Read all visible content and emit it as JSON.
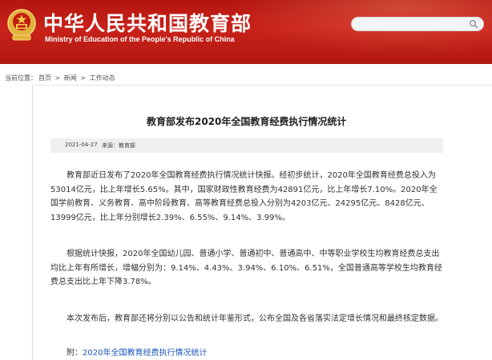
{
  "header": {
    "title": "中华人民共和国教育部",
    "subtitle": "Ministry of Education of the People's Republic of China",
    "search": {
      "value": "",
      "placeholder": ""
    },
    "colors": {
      "banner": "#c01d15"
    }
  },
  "breadcrumb": {
    "label": "当前位置：",
    "items": [
      "首页",
      "新闻",
      "工作动态"
    ],
    "separator": ">"
  },
  "article": {
    "title": "教育部发布2020年全国教育经费执行情况统计",
    "date": "2021-04-27",
    "source": "来源：教育部",
    "paragraphs": [
      "教育部近日发布了2020年全国教育经费执行情况统计快报。经初步统计，2020年全国教育经费总投入为53014亿元，比上年增长5.65%。其中，国家财政性教育经费为42891亿元，比上年增长7.10%。2020年全国学前教育、义务教育、高中阶段教育、高等教育经费总投入分别为4203亿元、24295亿元、8428亿元、13999亿元，比上年分别增长2.39%、6.55%、9.14%、3.99%。",
      "根据统计快报，2020年全国幼儿园、普通小学、普通初中、普通高中、中等职业学校生均教育经费总支出均比上年有所增长，增幅分别为：9.14%、4.43%、3.94%、6.10%、6.51%，全国普通高等学校生均教育经费总支出比上年下降3.78%。",
      "本次发布后，教育部还将分别以公告和统计年鉴形式，公布全国及各省落实法定增长情况和最终核定数据。"
    ],
    "attachment_label": "附：",
    "attachment_link": "2020年全国教育经费执行情况统计"
  }
}
